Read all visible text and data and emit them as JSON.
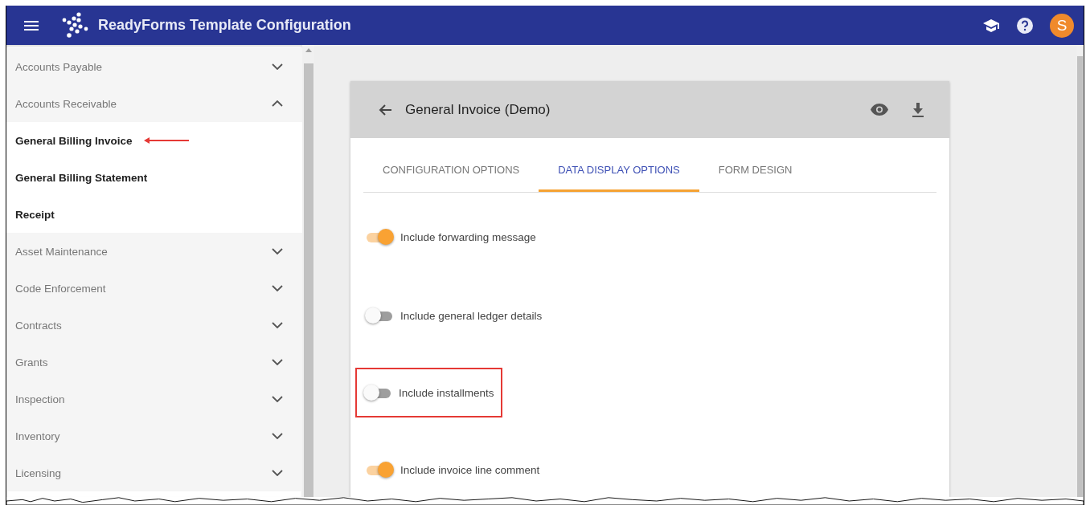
{
  "app_bar": {
    "title": "ReadyForms Template Configuration",
    "avatar": "S"
  },
  "sidebar": {
    "items": [
      {
        "label": "Accounts Payable",
        "expanded": false
      },
      {
        "label": "Accounts Receivable",
        "expanded": true,
        "children": [
          {
            "label": "General Billing Invoice",
            "annotated": true
          },
          {
            "label": "General Billing Statement",
            "annotated": false
          },
          {
            "label": "Receipt",
            "annotated": false
          }
        ]
      },
      {
        "label": "Asset Maintenance",
        "expanded": false
      },
      {
        "label": "Code Enforcement",
        "expanded": false
      },
      {
        "label": "Contracts",
        "expanded": false
      },
      {
        "label": "Grants",
        "expanded": false
      },
      {
        "label": "Inspection",
        "expanded": false
      },
      {
        "label": "Inventory",
        "expanded": false
      },
      {
        "label": "Licensing",
        "expanded": false
      }
    ]
  },
  "card": {
    "title": "General Invoice (Demo)",
    "tabs": [
      {
        "label": "CONFIGURATION OPTIONS",
        "selected": false
      },
      {
        "label": "DATA DISPLAY OPTIONS",
        "selected": true
      },
      {
        "label": "FORM DESIGN",
        "selected": false
      }
    ],
    "options": [
      {
        "label": "Include forwarding message",
        "on": true,
        "highlighted": false
      },
      {
        "label": "Include general ledger details",
        "on": false,
        "highlighted": false
      },
      {
        "label": "Include installments",
        "on": false,
        "highlighted": true
      },
      {
        "label": "Include invoice line comment",
        "on": true,
        "highlighted": false
      }
    ]
  }
}
